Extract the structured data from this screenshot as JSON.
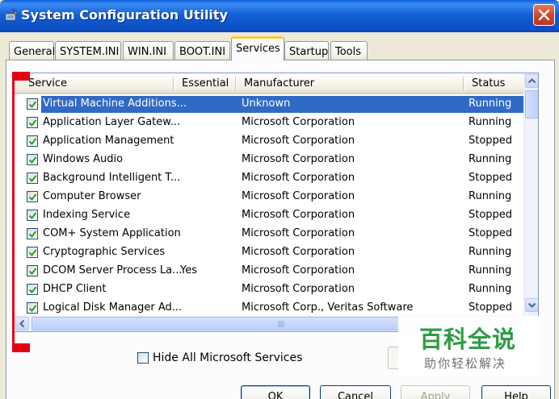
{
  "window": {
    "title": "System Configuration Utility"
  },
  "tabs": [
    {
      "label": "General"
    },
    {
      "label": "SYSTEM.INI"
    },
    {
      "label": "WIN.INI"
    },
    {
      "label": "BOOT.INI"
    },
    {
      "label": "Services"
    },
    {
      "label": "Startup"
    },
    {
      "label": "Tools"
    }
  ],
  "active_tab": "Services",
  "columns": {
    "service": "Service",
    "essential": "Essential",
    "manufacturer": "Manufacturer",
    "status": "Status"
  },
  "rows": [
    {
      "service": "Virtual Machine Additions...",
      "essential": "",
      "manufacturer": "Unknown",
      "status": "Running"
    },
    {
      "service": "Application Layer Gatew...",
      "essential": "",
      "manufacturer": "Microsoft Corporation",
      "status": "Running"
    },
    {
      "service": "Application Management",
      "essential": "",
      "manufacturer": "Microsoft Corporation",
      "status": "Stopped"
    },
    {
      "service": "Windows Audio",
      "essential": "",
      "manufacturer": "Microsoft Corporation",
      "status": "Running"
    },
    {
      "service": "Background Intelligent T...",
      "essential": "",
      "manufacturer": "Microsoft Corporation",
      "status": "Stopped"
    },
    {
      "service": "Computer Browser",
      "essential": "",
      "manufacturer": "Microsoft Corporation",
      "status": "Running"
    },
    {
      "service": "Indexing Service",
      "essential": "",
      "manufacturer": "Microsoft Corporation",
      "status": "Stopped"
    },
    {
      "service": "COM+ System Application",
      "essential": "",
      "manufacturer": "Microsoft Corporation",
      "status": "Stopped"
    },
    {
      "service": "Cryptographic Services",
      "essential": "",
      "manufacturer": "Microsoft Corporation",
      "status": "Running"
    },
    {
      "service": "DCOM Server Process La...",
      "essential": "Yes",
      "manufacturer": "Microsoft Corporation",
      "status": "Running"
    },
    {
      "service": "DHCP Client",
      "essential": "",
      "manufacturer": "Microsoft Corporation",
      "status": "Running"
    },
    {
      "service": "Logical Disk Manager Ad...",
      "essential": "",
      "manufacturer": "Microsoft Corp., Veritas Software",
      "status": "Stopped"
    }
  ],
  "hide_ms": {
    "label": "Hide All Microsoft Services"
  },
  "buttons": {
    "ok": "OK",
    "cancel": "Cancel",
    "apply": "Apply",
    "help": "Help"
  },
  "watermark": {
    "title": "百科全说",
    "subtitle": "助你轻松解决"
  },
  "colors": {
    "selection": "#316AC5",
    "titlebar": "#0B4FC4",
    "annotation_red": "#E60012",
    "watermark_green": "#2E9C43"
  }
}
